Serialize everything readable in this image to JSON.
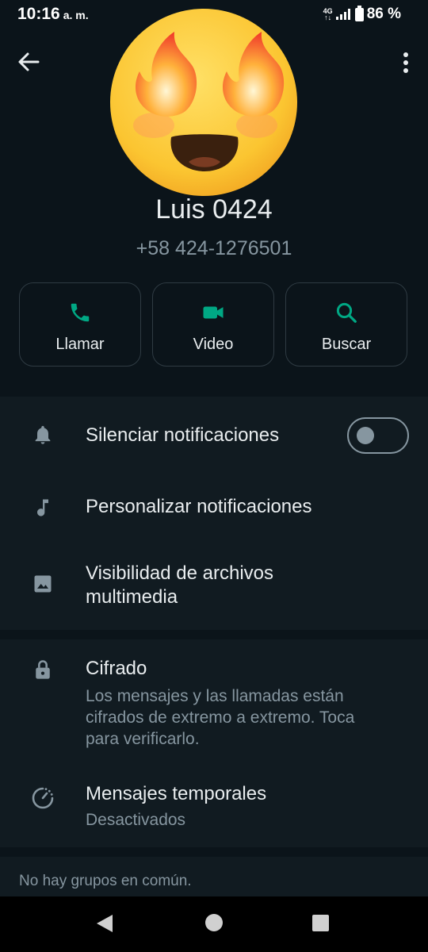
{
  "status_bar": {
    "time": "10:16",
    "ampm": "a. m.",
    "network": "4G",
    "battery_percent": "86 %"
  },
  "header": {
    "back_icon": "arrow-left-icon",
    "menu_icon": "more-vertical-icon",
    "avatar_icon": "heart-eyes-fire-emoji"
  },
  "contact": {
    "name": "Luis 0424",
    "phone": "+58 424-1276501"
  },
  "actions": [
    {
      "label": "Llamar",
      "icon": "phone-icon"
    },
    {
      "label": "Video",
      "icon": "video-icon"
    },
    {
      "label": "Buscar",
      "icon": "search-icon"
    }
  ],
  "notifications": {
    "mute_label": "Silenciar notificaciones",
    "mute_enabled": false,
    "customize_label": "Personalizar notificaciones",
    "media_visibility_label_line1": "Visibilidad de archivos",
    "media_visibility_label_line2": "multimedia"
  },
  "privacy": {
    "encryption_title": "Cifrado",
    "encryption_line1": "Los mensajes y las llamadas están",
    "encryption_line2": "cifrados de extremo a extremo. Toca",
    "encryption_line3": "para verificarlo.",
    "disappearing_title": "Mensajes temporales",
    "disappearing_status": "Desactivados"
  },
  "groups": {
    "no_common_groups": "No hay grupos en común."
  },
  "colors": {
    "background": "#0b141a",
    "section": "#111b21",
    "accent": "#00a884",
    "secondary_text": "#8696a0"
  }
}
